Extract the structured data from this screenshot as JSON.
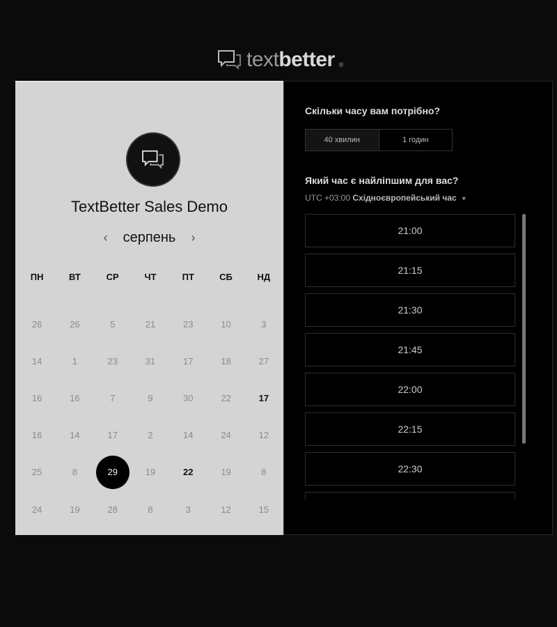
{
  "logo": {
    "part1": "text",
    "part2": "better",
    "mark": "®",
    "icon": "chat-bubbles-icon"
  },
  "event": {
    "title": "TextBetter Sales Demo",
    "avatar_icon": "chat-bubbles-icon"
  },
  "calendar": {
    "month": "серпень",
    "prev_icon": "chevron-left-icon",
    "next_icon": "chevron-right-icon",
    "weekdays": [
      "ПН",
      "ВТ",
      "СР",
      "ЧТ",
      "ПТ",
      "СБ",
      "НД"
    ],
    "weeks": [
      [
        "26",
        "26",
        "5",
        "21",
        "23",
        "10",
        "3"
      ],
      [
        "14",
        "1",
        "23",
        "31",
        "17",
        "18",
        "27"
      ],
      [
        "16",
        "16",
        "7",
        "9",
        "30",
        "22",
        "17"
      ],
      [
        "16",
        "14",
        "17",
        "2",
        "14",
        "24",
        "12"
      ],
      [
        "25",
        "8",
        "29",
        "19",
        "22",
        "19",
        "8"
      ],
      [
        "24",
        "19",
        "28",
        "8",
        "3",
        "12",
        "15"
      ]
    ]
  },
  "duration": {
    "question": "Скільки часу вам потрібно?",
    "options": [
      "40 хвилин",
      "1 годин"
    ],
    "selected": "40 хвилин"
  },
  "time": {
    "question": "Який час є найліпшим для вас?",
    "timezone_offset": "UTC +03:00",
    "timezone_name": "Східноєвропейський час",
    "slots": [
      "21:00",
      "21:15",
      "21:30",
      "21:45",
      "22:00",
      "22:15",
      "22:30"
    ]
  },
  "colors": {
    "panel_left": "#d4d4d4",
    "panel_right": "#000000",
    "selected_day": "#000000"
  }
}
